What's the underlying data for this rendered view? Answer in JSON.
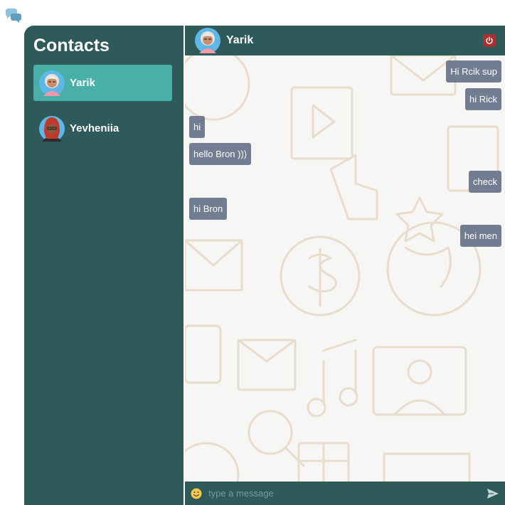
{
  "sidebar": {
    "title": "Contacts",
    "contacts": [
      {
        "name": "Yarik",
        "active": true
      },
      {
        "name": "Yevheniia",
        "active": false
      }
    ]
  },
  "chat": {
    "contact_name": "Yarik",
    "messages": [
      {
        "text": "Hi Rcik sup",
        "direction": "out"
      },
      {
        "text": "hi Rick",
        "direction": "out"
      },
      {
        "text": "hi",
        "direction": "in"
      },
      {
        "text": "hello Bron )))",
        "direction": "in"
      },
      {
        "text": "check",
        "direction": "out"
      },
      {
        "text": "hi Bron",
        "direction": "in"
      },
      {
        "text": "hei men",
        "direction": "out"
      }
    ],
    "composer_placeholder": "type a message"
  },
  "icons": {
    "logo": "chat-bubbles-icon",
    "power": "power-icon",
    "emoji": "smiley-icon",
    "send": "paper-plane-icon"
  },
  "colors": {
    "panel": "#2e5a5a",
    "active_contact": "#48b0a8",
    "bubble": "#727d91",
    "power_button": "#a83232",
    "chat_bg": "#f6f6f4"
  }
}
